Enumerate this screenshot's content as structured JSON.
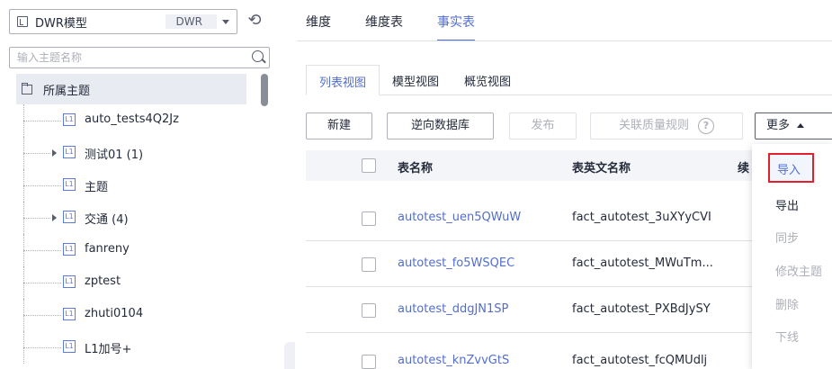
{
  "sidebar": {
    "model_name": "DWR模型",
    "model_code": "DWR",
    "search_placeholder": "输入主题名称",
    "root_label": "所属主题",
    "badge": "L1",
    "nodes": [
      {
        "label": "auto_tests4Q2Jz",
        "expandable": false
      },
      {
        "label": "测试01 (1)",
        "expandable": true
      },
      {
        "label": "主题",
        "expandable": false
      },
      {
        "label": "交通 (4)",
        "expandable": true
      },
      {
        "label": "fanreny",
        "expandable": false
      },
      {
        "label": "zptest",
        "expandable": false
      },
      {
        "label": "zhuti0104",
        "expandable": false
      },
      {
        "label": "L1加号+",
        "expandable": false
      }
    ]
  },
  "tabs": {
    "top": [
      "维度",
      "维度表",
      "事实表"
    ],
    "active_top": "事实表",
    "views": [
      "列表视图",
      "模型视图",
      "概览视图"
    ],
    "active_view": "列表视图"
  },
  "toolbar": {
    "new": "新建",
    "reverse_db": "逆向数据库",
    "publish": "发布",
    "quality_rule": "关联质量规则",
    "more": "更多"
  },
  "table": {
    "columns": [
      "表名称",
      "表英文名称",
      "续"
    ],
    "rows": [
      {
        "name": "autotest_uen5QWuW",
        "en_name": "fact_autotest_3uXYyCVI"
      },
      {
        "name": "autotest_fo5WSQEC",
        "en_name": "fact_autotest_MWuTm..."
      },
      {
        "name": "autotest_ddgJN1SP",
        "en_name": "fact_autotest_PXBdJySY"
      },
      {
        "name": "autotest_knZvvGtS",
        "en_name": "fact_autotest_fcQMUdlj"
      }
    ]
  },
  "more_menu": {
    "items": [
      {
        "label": "导入",
        "enabled": true,
        "highlighted": true
      },
      {
        "label": "导出",
        "enabled": true
      },
      {
        "label": "同步",
        "enabled": false
      },
      {
        "label": "修改主题",
        "enabled": false
      },
      {
        "label": "删除",
        "enabled": false
      },
      {
        "label": "下线",
        "enabled": false
      }
    ]
  },
  "colors": {
    "accent": "#526ecc",
    "highlight_border": "#e0202a",
    "disabled": "#adb0b8"
  }
}
